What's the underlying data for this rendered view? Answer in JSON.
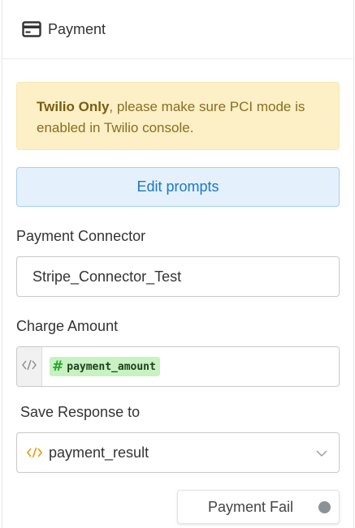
{
  "header": {
    "title": "Payment",
    "icon": "credit-card-icon"
  },
  "warning": {
    "bold": "Twilio Only",
    "text": ", please make sure PCI mode is enabled in Twilio console."
  },
  "edit_prompts": {
    "label": "Edit prompts"
  },
  "connector": {
    "label": "Payment Connector",
    "value": "Stripe_Connector_Test"
  },
  "charge": {
    "label": "Charge Amount",
    "icon": "code-icon",
    "variable_symbol": "#",
    "variable": "payment_amount"
  },
  "save_response": {
    "label": "Save Response to",
    "icon": "code-icon",
    "value": "payment_result",
    "dropdown_icon": "chevron-down-icon"
  },
  "fail_port": {
    "label": "Payment Fail"
  },
  "colors": {
    "warning_bg": "#fdf0c7",
    "warning_text": "#8a6d1f",
    "primary": "#1a78c8",
    "primary_bg": "#e4f1fd",
    "variable_chip": "#c8f2c2",
    "code_icon_orange": "#f0a01e",
    "port_dot": "#8c9097"
  }
}
